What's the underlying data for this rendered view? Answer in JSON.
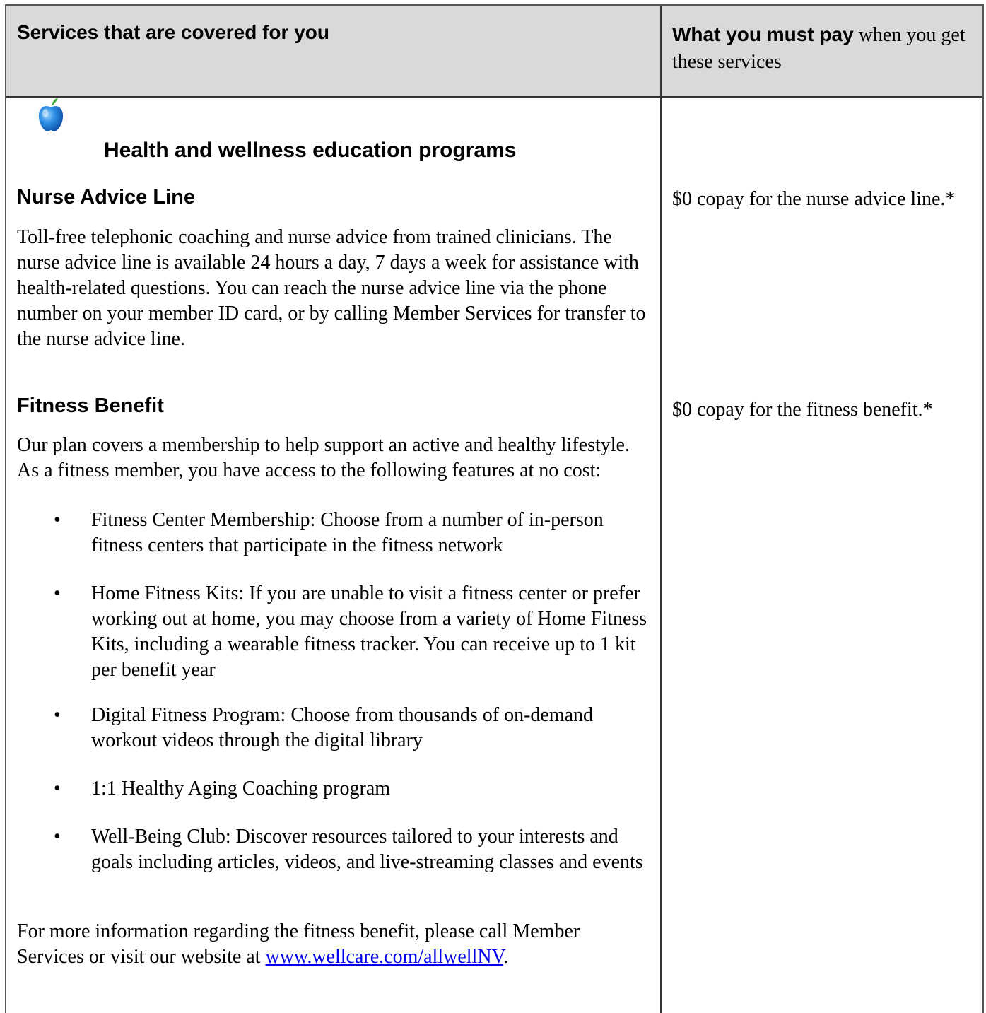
{
  "header": {
    "left": "Services that are covered for you",
    "right_strong": "What you must pay",
    "right_rest": " when you get these services"
  },
  "section": {
    "icon": "apple-icon",
    "title": "Health and wellness education programs"
  },
  "nurse": {
    "title": "Nurse Advice Line",
    "body": "Toll-free telephonic coaching and nurse advice from trained clinicians. The nurse advice line is available 24 hours a day, 7 days a week for assistance with health-related questions. You can reach the nurse advice line via the phone number on your member ID card, or by calling Member Services for transfer to the nurse advice line.",
    "copay": "$0 copay for the nurse advice line.*"
  },
  "fitness": {
    "title": "Fitness Benefit",
    "intro": "Our plan covers a membership to help support an active and healthy lifestyle. As a fitness member, you have access to the following features at no cost:",
    "bullets": [
      "Fitness Center Membership: Choose from a number of in-person fitness centers that participate in the fitness network",
      "Home Fitness Kits: If you are unable to visit a fitness center or prefer working out at home, you may choose from a variety of Home Fitness Kits, including a wearable fitness tracker. You can receive up to 1 kit per benefit year",
      "Digital Fitness Program: Choose from thousands of on-demand workout videos through the digital library",
      "1:1 Healthy Aging Coaching program",
      "Well-Being Club: Discover resources tailored to your interests and goals including articles, videos, and live-streaming classes and events"
    ],
    "bullet_symbol": "•",
    "footer_text": "For more information regarding the fitness benefit, please call Member Services or visit our website at ",
    "footer_link": "www.wellcare.com/allwellNV",
    "footer_end": ".",
    "copay": "$0 copay for the fitness benefit.*"
  },
  "colors": {
    "header_bg": "#d9d9d9",
    "link": "#0000ee"
  }
}
